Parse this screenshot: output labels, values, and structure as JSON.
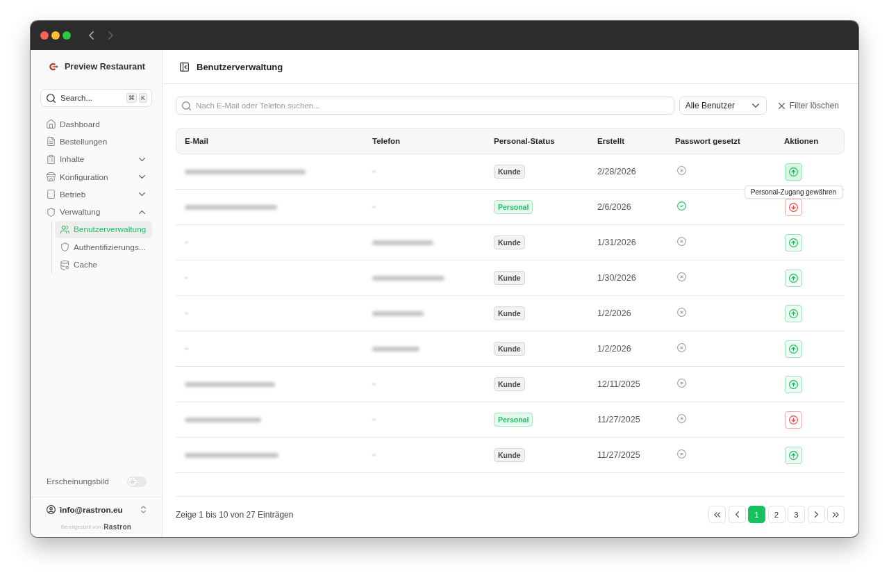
{
  "window": {
    "back_enabled": true,
    "forward_enabled": false
  },
  "sidebar": {
    "brand": "Preview Restaurant",
    "search": {
      "placeholder": "Search...",
      "shortcut": [
        "⌘",
        "K"
      ]
    },
    "items": [
      {
        "label": "Dashboard",
        "selected": false
      },
      {
        "label": "Bestellungen",
        "selected": false
      },
      {
        "label": "Inhalte",
        "selected": false,
        "expanded": false
      },
      {
        "label": "Konfiguration",
        "selected": false,
        "expanded": false
      },
      {
        "label": "Betrieb",
        "selected": false,
        "expanded": false
      },
      {
        "label": "Verwaltung",
        "selected": false,
        "expanded": true,
        "children": [
          {
            "label": "Benutzerverwaltung",
            "selected": true
          },
          {
            "label": "Authentifizierungs...",
            "selected": false
          },
          {
            "label": "Cache",
            "selected": false
          }
        ]
      }
    ],
    "appearance": {
      "label": "Erscheinungsbild",
      "on": false
    },
    "account": {
      "email": "info@rastron.eu"
    },
    "credit": {
      "text": "Bereitgestellt von",
      "brand": "Rastron"
    }
  },
  "header": {
    "title": "Benutzerverwaltung"
  },
  "filters": {
    "search": {
      "placeholder": "Nach E-Mail oder Telefon suchen..."
    },
    "role_select": {
      "value": "Alle Benutzer"
    },
    "clear": "Filter löschen"
  },
  "table": {
    "columns": [
      "E-Mail",
      "Telefon",
      "Personal-Status",
      "Erstellt",
      "Passwort gesetzt",
      "Aktionen"
    ],
    "rows": [
      {
        "email": {
          "kind": "blurred"
        },
        "phone": {
          "kind": "blank"
        },
        "status": {
          "label": "Kunde",
          "kind": "customer"
        },
        "created": "2/28/2026",
        "password_set": false,
        "action": {
          "kind": "grant",
          "tooltip": "Personal-Zugang gewähren"
        }
      },
      {
        "email": {
          "kind": "blurred"
        },
        "phone": {
          "kind": "blank"
        },
        "status": {
          "label": "Personal",
          "kind": "staff"
        },
        "created": "2/6/2026",
        "password_set": true,
        "action": {
          "kind": "revoke"
        }
      },
      {
        "email": {
          "kind": "blank"
        },
        "phone": {
          "kind": "blurred"
        },
        "status": {
          "label": "Kunde",
          "kind": "customer"
        },
        "created": "1/31/2026",
        "password_set": false,
        "action": {
          "kind": "grant"
        }
      },
      {
        "email": {
          "kind": "blank"
        },
        "phone": {
          "kind": "blurred"
        },
        "status": {
          "label": "Kunde",
          "kind": "customer"
        },
        "created": "1/30/2026",
        "password_set": false,
        "action": {
          "kind": "grant"
        }
      },
      {
        "email": {
          "kind": "blank"
        },
        "phone": {
          "kind": "blurred"
        },
        "status": {
          "label": "Kunde",
          "kind": "customer"
        },
        "created": "1/2/2026",
        "password_set": false,
        "action": {
          "kind": "grant"
        }
      },
      {
        "email": {
          "kind": "blank"
        },
        "phone": {
          "kind": "blurred"
        },
        "status": {
          "label": "Kunde",
          "kind": "customer"
        },
        "created": "1/2/2026",
        "password_set": false,
        "action": {
          "kind": "grant"
        }
      },
      {
        "email": {
          "kind": "blurred"
        },
        "phone": {
          "kind": "blank"
        },
        "status": {
          "label": "Kunde",
          "kind": "customer"
        },
        "created": "12/11/2025",
        "password_set": false,
        "action": {
          "kind": "grant"
        }
      },
      {
        "email": {
          "kind": "blurred"
        },
        "phone": {
          "kind": "blank"
        },
        "status": {
          "label": "Personal",
          "kind": "staff"
        },
        "created": "11/27/2025",
        "password_set": false,
        "action": {
          "kind": "revoke"
        }
      },
      {
        "email": {
          "kind": "blurred"
        },
        "phone": {
          "kind": "blank"
        },
        "status": {
          "label": "Kunde",
          "kind": "customer"
        },
        "created": "11/27/2025",
        "password_set": false,
        "action": {
          "kind": "grant"
        }
      }
    ]
  },
  "footer": {
    "summary": "Zeige 1 bis 10 von 27 Einträgen",
    "pages": [
      {
        "label": "1",
        "selected": true
      },
      {
        "label": "2",
        "selected": false
      },
      {
        "label": "3",
        "selected": false
      }
    ]
  }
}
